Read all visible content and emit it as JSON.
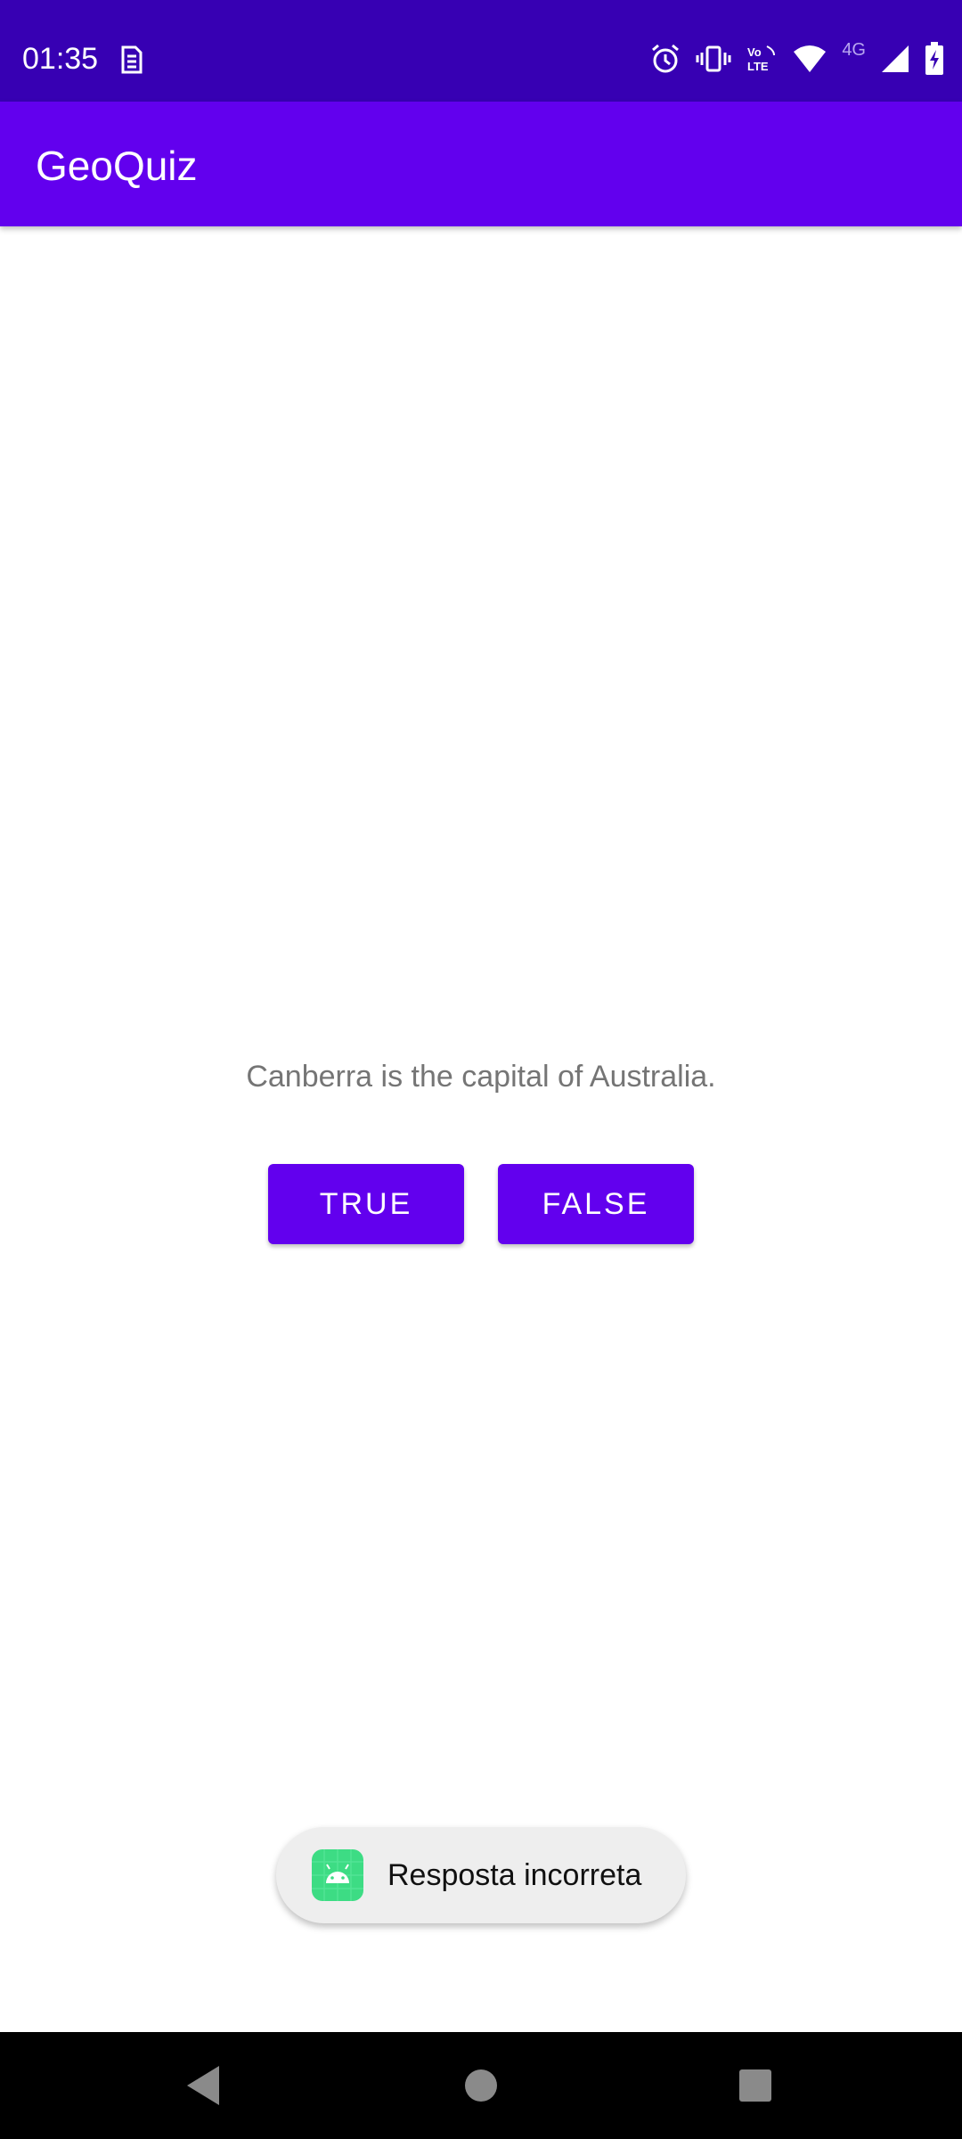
{
  "status_bar": {
    "time": "01:35",
    "network_label": "4G",
    "icons": [
      "sim-icon",
      "alarm-icon",
      "vibrate-icon",
      "volte-icon",
      "wifi-icon",
      "signal-icon",
      "battery-charging-icon"
    ]
  },
  "app_bar": {
    "title": "GeoQuiz"
  },
  "quiz": {
    "question": "Canberra is the capital of Australia.",
    "true_label": "TRUE",
    "false_label": "FALSE"
  },
  "toast": {
    "message": "Resposta incorreta",
    "icon": "android-app-icon"
  },
  "nav_bar": {
    "buttons": [
      "back-icon",
      "home-icon",
      "recents-icon"
    ]
  },
  "colors": {
    "status_bar": "#3700B3",
    "primary": "#6200EE",
    "android_green": "#3ddc84"
  }
}
